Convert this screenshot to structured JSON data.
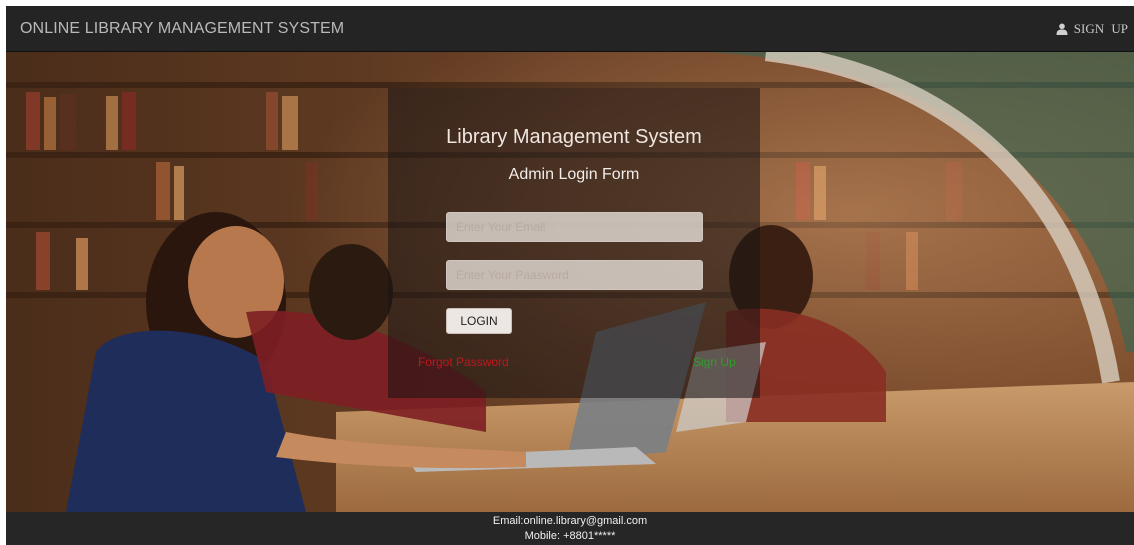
{
  "navbar": {
    "brand": "ONLINE LIBRARY MANAGEMENT SYSTEM",
    "signup_label": "SIGN UP",
    "signup_icon": "user-icon"
  },
  "login": {
    "title": "Library Management System",
    "subtitle": "Admin Login Form",
    "email_placeholder": "Enter Your Email",
    "password_placeholder": "Enter Your Paasword",
    "login_button": "LOGIN",
    "forgot_password": "Forgot Password",
    "sign_up": "Sign Up"
  },
  "footer": {
    "email": "Email:online.library@gmail.com",
    "mobile": "Mobile: +8801*****"
  },
  "colors": {
    "navbar_bg": "#242424",
    "forgot_link": "#c0171c",
    "signup_link": "#2e9e2a",
    "footer_bg": "#262626"
  }
}
